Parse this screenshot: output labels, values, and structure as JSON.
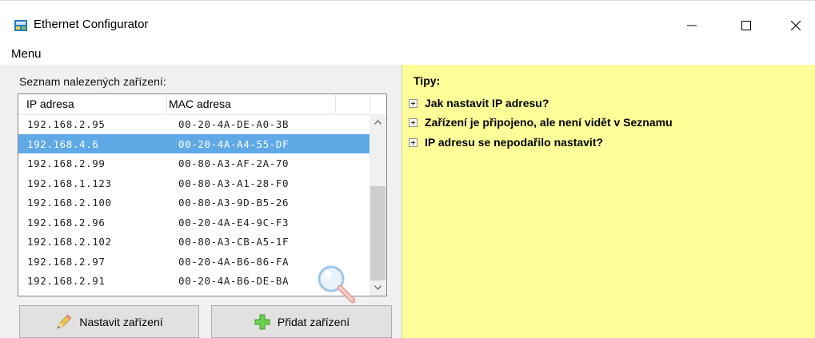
{
  "window": {
    "title": "Ethernet Configurator"
  },
  "menu": {
    "items": [
      "Menu"
    ]
  },
  "device_list": {
    "label": "Seznam nalezených zařízení:",
    "columns": [
      "IP adresa",
      "MAC adresa"
    ],
    "rows": [
      {
        "ip": "192.168.2.95",
        "mac": "00-20-4A-DE-A0-3B"
      },
      {
        "ip": "192.168.4.6",
        "mac": "00-20-4A-A4-55-DF"
      },
      {
        "ip": "192.168.2.99",
        "mac": "00-80-A3-AF-2A-70"
      },
      {
        "ip": "192.168.1.123",
        "mac": "00-80-A3-A1-28-F0"
      },
      {
        "ip": "192.168.2.100",
        "mac": "00-80-A3-9D-B5-26"
      },
      {
        "ip": "192.168.2.96",
        "mac": "00-20-4A-E4-9C-F3"
      },
      {
        "ip": "192.168.2.102",
        "mac": "00-80-A3-CB-A5-1F"
      },
      {
        "ip": "192.168.2.97",
        "mac": "00-20-4A-B6-86-FA"
      },
      {
        "ip": "192.168.2.91",
        "mac": "00-20-4A-B6-DE-BA"
      }
    ],
    "selected_index": 1
  },
  "buttons": {
    "configure": "Nastavit zařízení",
    "add": "Přidat zařízení"
  },
  "tips": {
    "title": "Tipy:",
    "items": [
      "Jak nastavit IP adresu?",
      "Zařízení je připojeno, ale není vidět v Seznamu",
      "IP adresu se nepodařilo nastavit?"
    ]
  },
  "colors": {
    "selection": "#5fa9e7",
    "tips_background": "#ffff99",
    "button_face": "#e1e1e1"
  },
  "icons": {
    "app": "ethernet-app-icon",
    "minimize": "minimize-icon",
    "maximize": "maximize-icon",
    "close": "close-icon",
    "configure": "pencil-icon",
    "add": "green-plus-icon",
    "search": "magnifier-icon",
    "expand": "plus-box-icon"
  }
}
